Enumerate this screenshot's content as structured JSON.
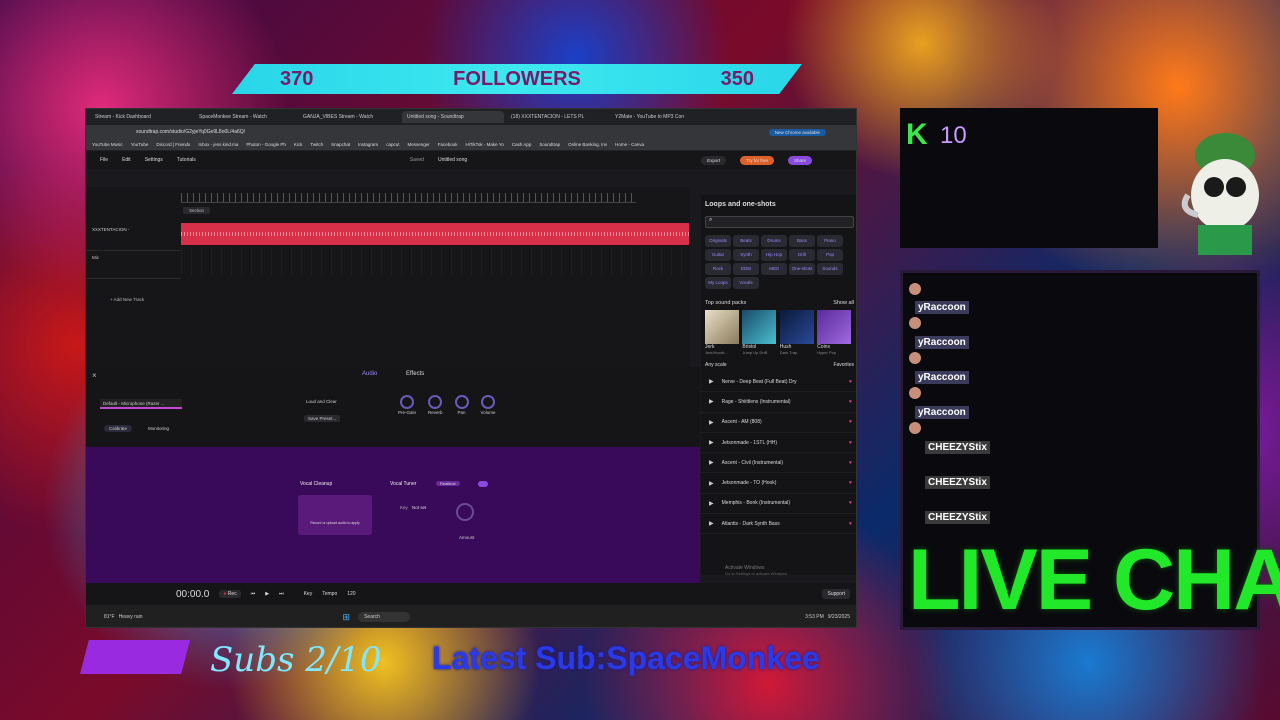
{
  "banner": {
    "left_count": "370",
    "label": "FOLLOWERS",
    "right_count": "350"
  },
  "browser": {
    "tabs": [
      "Stream - Kick Dashboard",
      "SpaceMonkee Stream - Watch",
      "GANJA_VIBES Stream - Watch",
      "Untitled song - Soundtrap",
      "(18) XXXTENTACION - LETS PL",
      "Y2Mate - YouTube to MP3 Con"
    ],
    "url": "soundtrap.com/studio/G2yjeYq0Ge9L8o0L/4a6Q/",
    "update_label": "New Chrome available",
    "bookmarks": [
      "YouTube Music",
      "YouTube",
      "Discord | Friends",
      "Inbox - jess.kind.ma",
      "Photon - Google Ph",
      "Kick",
      "Twitch",
      "Snapchat",
      "Instagram",
      "capcut",
      "Messenger",
      "Facebook",
      "HiTikTok - Make Yo",
      "Cash App",
      "Soundtrap",
      "Online Banking, Inv",
      "Home - Canva"
    ]
  },
  "app": {
    "menu": [
      "File",
      "Edit",
      "Settings",
      "Tutorials"
    ],
    "saved_label": "Saved",
    "song_title": "Untitled song",
    "export_label": "Export",
    "try_label": "Try for free",
    "share_label": "Share",
    "section_label": "Section",
    "tracks": [
      {
        "name": "XXXTENTACION -"
      },
      {
        "name": "Mic"
      }
    ],
    "add_track": "+ Add New Track"
  },
  "sidebar": {
    "title": "Loops and one-shots",
    "filters": [
      "Originals",
      "Beats",
      "Drums",
      "Bass",
      "Piano",
      "Guitar",
      "Synth",
      "Hip Hop",
      "Drill",
      "Pop",
      "Rock",
      "EDM",
      "MIDI",
      "One-shots",
      "Sounds",
      "My Loops",
      "Vocals"
    ],
    "packs_title": "Top sound packs",
    "show_all": "Show all",
    "packs": [
      {
        "name": "Jerk",
        "sub": "Jerk/Hoodt..."
      },
      {
        "name": "Bristol",
        "sub": "Jump Up DnB"
      },
      {
        "name": "Hush",
        "sub": "Dark Trap"
      },
      {
        "name": "Coins",
        "sub": "Hyper Pop"
      }
    ],
    "scale_label": "Any scale",
    "favorites_label": "Favorites",
    "songs": [
      "Nerve - Deep Beat (Full Beat) Dry",
      "Rage - Shiittlens (Instrumental)",
      "Ascent - AM (808)",
      "Jetsonmade - 1STL (HH)",
      "Ascent - Civil (Instrumental)",
      "Jetsonmade - TO (Hook)",
      "Memphis - Bonk (Instrumental)",
      "Atlantis - Dark Synth Bass"
    ],
    "activate": "Activate Windows",
    "activate_sub": "Go to Settings to activate Windows."
  },
  "effects": {
    "tabs": [
      "Audio",
      "Effects"
    ],
    "device": "Default - Microphone (Razer ...",
    "calibrate": "Calibrate",
    "monitoring": "Monitoring",
    "preset": "Loud and Clear",
    "save_preset": "Save Preset...",
    "knobs": [
      "Pre-Gain",
      "Reverb",
      "Pan",
      "Volume"
    ],
    "vocal_cleanup": "Vocal Cleanup",
    "vocal_cleanup_hint": "Record or upload audio to apply",
    "vocal_tuner": "Vocal Tuner",
    "realtime": "Realtime",
    "key_label": "Key",
    "key_value": "Not set",
    "amount": "Amount"
  },
  "transport": {
    "time": "00:00.0",
    "rec": "Rec",
    "key": "Key",
    "tempo_label": "Tempo",
    "tempo": "120",
    "support": "Support"
  },
  "taskbar": {
    "weather": "81°F",
    "weather_desc": "Heavy rain",
    "search": "Search",
    "time": "3:53 PM",
    "date": "9/23/2025"
  },
  "kick": {
    "letter": "K",
    "count": "10"
  },
  "chat": {
    "messages": [
      {
        "user": "yRaccoon"
      },
      {
        "user": "yRaccoon"
      },
      {
        "user": "yRaccoon"
      },
      {
        "user": "yRaccoon"
      },
      {
        "user": "CHEEZYStix"
      },
      {
        "user": "CHEEZYStix"
      },
      {
        "user": "CHEEZYStix"
      }
    ],
    "live_label": "LIVE CHAT"
  },
  "bottom": {
    "subs": "Subs 2/10",
    "latest": "Latest Sub:SpaceMonkee"
  },
  "colors": {
    "accent_red": "#d9304a",
    "purple": "#3a0a5a",
    "chat_green": "#22e82a",
    "banner_cyan": "#3ee8f0"
  }
}
